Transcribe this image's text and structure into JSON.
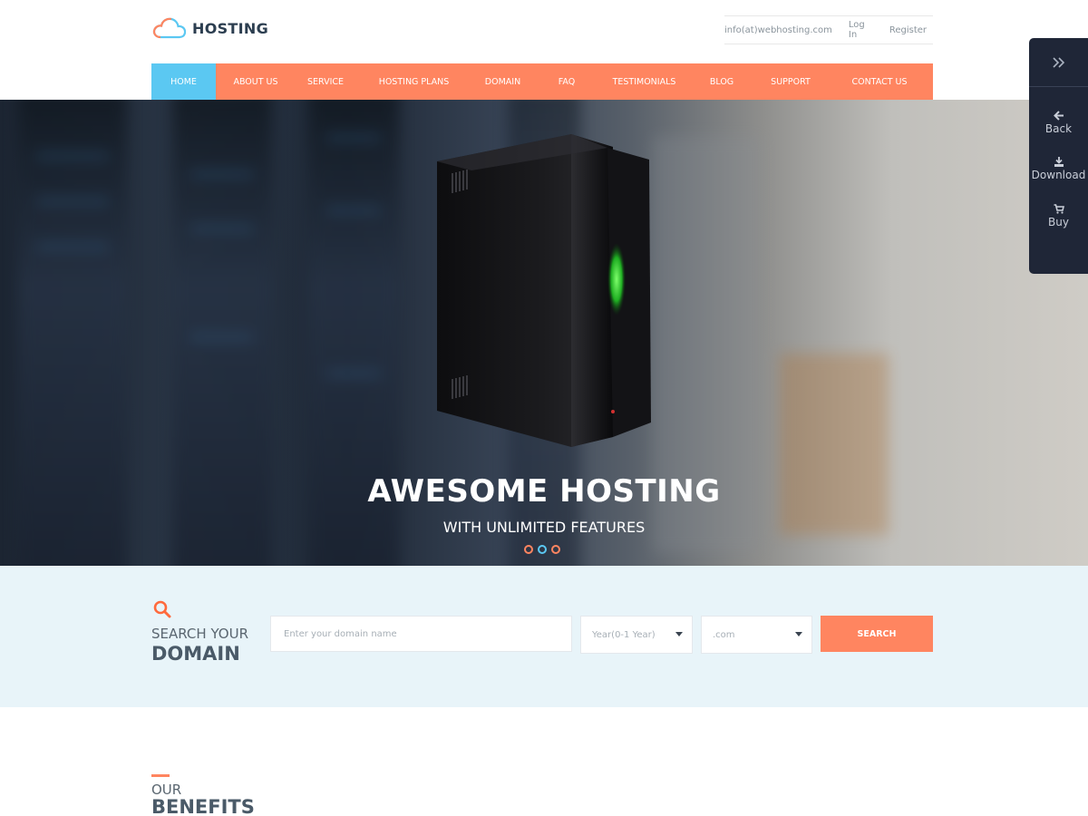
{
  "brand": {
    "name": "HOSTING",
    "logo_icon": "cloud-icon",
    "colors": {
      "accent": "#ff8560",
      "active": "#5bc8f2",
      "dark": "#2c3e50"
    }
  },
  "toplinks": {
    "email": "info(at)webhosting.com",
    "login": "Log In",
    "register": "Register"
  },
  "nav": {
    "items": [
      {
        "label": "HOME",
        "active": true
      },
      {
        "label": "ABOUT US"
      },
      {
        "label": "SERVICE"
      },
      {
        "label": "HOSTING PLANS"
      },
      {
        "label": "DOMAIN"
      },
      {
        "label": "FAQ"
      },
      {
        "label": "TESTIMONIALS"
      },
      {
        "label": "BLOG"
      },
      {
        "label": "SUPPORT"
      },
      {
        "label": "CONTACT US"
      }
    ]
  },
  "hero": {
    "title": "AWESOME HOSTING",
    "subtitle": "WITH UNLIMITED FEATURES",
    "image": "server-tower",
    "slides": 3,
    "active_slide": 2
  },
  "side_panel": {
    "toggle_icon": "double-chevron-right-icon",
    "items": [
      {
        "label": "Back",
        "icon": "arrow-left-icon"
      },
      {
        "label": "Download",
        "icon": "download-icon"
      },
      {
        "label": "Buy",
        "icon": "cart-icon"
      }
    ]
  },
  "search": {
    "heading_line1": "SEARCH YOUR",
    "heading_line2": "DOMAIN",
    "icon": "search-icon",
    "placeholder": "Enter your domain name",
    "year_select": "Year(0-1 Year)",
    "tld_select": ".com",
    "button": "SEARCH"
  },
  "benefits": {
    "line1": "OUR",
    "line2": "BENEFITS"
  }
}
